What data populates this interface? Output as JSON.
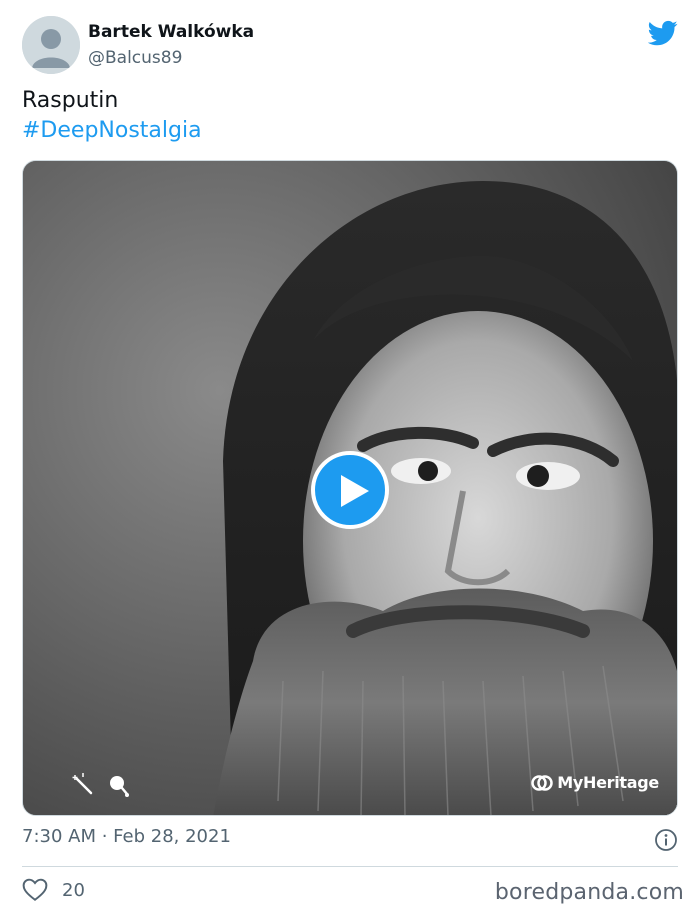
{
  "author": {
    "display_name": "Bartek Walkówka",
    "handle": "@Balcus89"
  },
  "tweet": {
    "text_line1": "Rasputin",
    "hashtag": "#DeepNostalgia",
    "timestamp": "7:30 AM · Feb 28, 2021",
    "like_count": "20"
  },
  "media": {
    "type": "video",
    "overlay_brand": "MyHeritage"
  },
  "watermark": "boredpanda.com",
  "icons": {
    "brand": "twitter-bird-icon",
    "play": "play-icon",
    "info": "info-icon",
    "like": "heart-icon",
    "wand": "magic-wand-icon",
    "enhance": "enhance-icon"
  },
  "colors": {
    "accent": "#1d9bf0",
    "text_primary": "#0f1419",
    "text_secondary": "#536471",
    "border": "#cfd9de"
  }
}
